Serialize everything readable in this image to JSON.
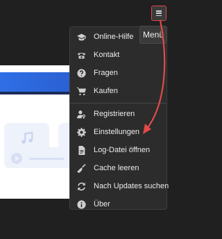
{
  "header": {
    "menu_tooltip": "Menü"
  },
  "menu": {
    "items": [
      {
        "label": "Online-Hilfe",
        "icon": "graduation-cap-icon"
      },
      {
        "label": "Kontakt",
        "icon": "phone-icon"
      },
      {
        "label": "Fragen",
        "icon": "question-circle-icon"
      },
      {
        "label": "Kaufen",
        "icon": "cart-icon"
      },
      {
        "label": "Registrieren",
        "icon": "user-key-icon"
      },
      {
        "label": "Einstellungen",
        "icon": "gear-icon"
      },
      {
        "label": "Log-Datei öffnen",
        "icon": "document-icon"
      },
      {
        "label": "Cache leeren",
        "icon": "broom-icon"
      },
      {
        "label": "Nach Updates suchen",
        "icon": "refresh-icon"
      },
      {
        "label": "Über",
        "icon": "info-icon"
      }
    ]
  },
  "colors": {
    "menu_bg": "#2c2c2c",
    "text": "#ececec",
    "icon": "#cfcfcf",
    "annotation_red": "#e24a4a",
    "app_accent": "#2f6fe6"
  },
  "annotation": {
    "target_item": "Log-Datei öffnen"
  }
}
